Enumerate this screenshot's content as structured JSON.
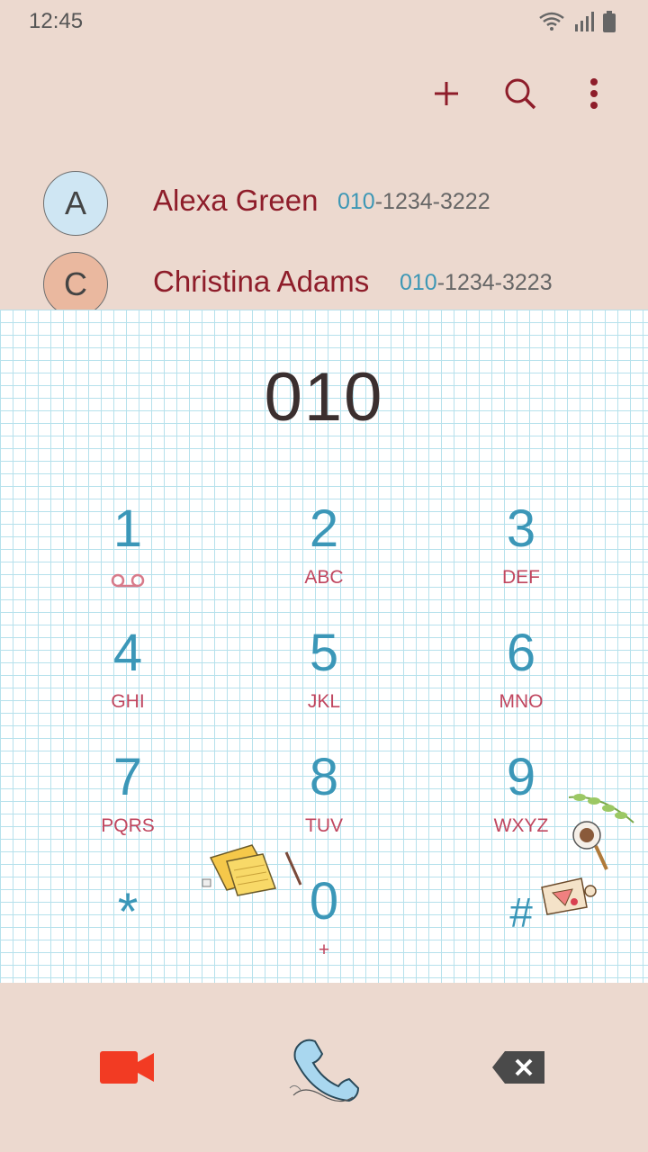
{
  "status": {
    "time": "12:45"
  },
  "toolbar": {
    "add_icon": "plus-icon",
    "search_icon": "search-icon",
    "more_icon": "more-vert-icon"
  },
  "contacts": [
    {
      "initial": "A",
      "name": "Alexa Green",
      "number_match": "010",
      "number_rest": "-1234-3222",
      "avatar_color": "#cfe6f3"
    },
    {
      "initial": "C",
      "name": "Christina Adams",
      "number_match": "010",
      "number_rest": "-1234-3223",
      "avatar_color": "#eab89f"
    }
  ],
  "dialer": {
    "entered_number": "010",
    "keys": [
      {
        "digit": "1",
        "letters": ""
      },
      {
        "digit": "2",
        "letters": "ABC"
      },
      {
        "digit": "3",
        "letters": "DEF"
      },
      {
        "digit": "4",
        "letters": "GHI"
      },
      {
        "digit": "5",
        "letters": "JKL"
      },
      {
        "digit": "6",
        "letters": "MNO"
      },
      {
        "digit": "7",
        "letters": "PQRS"
      },
      {
        "digit": "8",
        "letters": "TUV"
      },
      {
        "digit": "9",
        "letters": "WXYZ"
      },
      {
        "digit": "*",
        "letters": ""
      },
      {
        "digit": "0",
        "letters": "+"
      },
      {
        "digit": "#",
        "letters": ""
      }
    ]
  },
  "colors": {
    "accent": "#8e1d2a",
    "digit": "#3b97b8",
    "letters": "#c0465f",
    "video": "#f23b23"
  },
  "bottom": {
    "video_icon": "video-call-icon",
    "call_icon": "phone-icon",
    "backspace_icon": "backspace-icon"
  }
}
